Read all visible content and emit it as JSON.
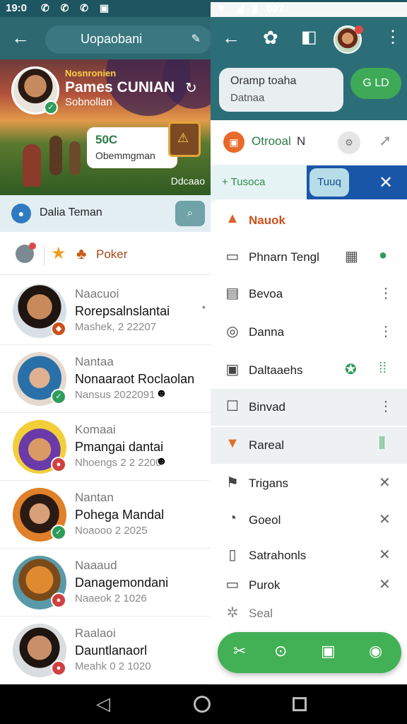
{
  "status": {
    "time": "19:0",
    "icons": "✆ ✆ ✆ ▣",
    "battery": "007"
  },
  "left": {
    "title": "Uopaobani",
    "banner": {
      "kicker": "Nosnronien",
      "name": "Pames CUNIAN",
      "sub": "Sobnollan",
      "card_amount": "50C",
      "card_label": "Obemmgman",
      "footer": "Ddcaao"
    },
    "search": {
      "label": "Dalia Teman"
    },
    "filter": {
      "tag": "Poker"
    },
    "chats": [
      {
        "top": "Naacuoi",
        "name": "Rorepsalnslantai",
        "sub": "Mashek, 2 22207",
        "badge_color": "#c8501a"
      },
      {
        "top": "Nantaa",
        "name": "Nonaaraot Roclaolan",
        "sub": "Nansus 2022091",
        "badge_color": "#2e9c5a"
      },
      {
        "top": "Komaai",
        "name": "Pmangai dantai",
        "sub": "Nhoengs 2 2 2200",
        "badge_color": "#d04040"
      },
      {
        "top": "Nantan",
        "name": "Pohega Mandal",
        "sub": "Noaooo 2 2025",
        "badge_color": "#2e9c5a"
      },
      {
        "top": "Naaaud",
        "name": "Danagemondani",
        "sub": "Naaeok 2 1026",
        "badge_color": "#d04040"
      },
      {
        "top": "Raalaoi",
        "name": "Dauntlanaorl",
        "sub": "Meahk 0 2 1020",
        "badge_color": "#d04040"
      }
    ]
  },
  "right": {
    "msg_line1": "Oramp toaha",
    "msg_line2": "Datnaa",
    "go_label": "G LD",
    "open_row": {
      "label": "Otrooal",
      "suffix": "N"
    },
    "tabs": {
      "left": "+ Tusoca",
      "active": "Tuuq"
    },
    "menu": [
      {
        "label": "Nauok"
      },
      {
        "label": "Phnarn Tengl"
      },
      {
        "label": "Bevoa"
      },
      {
        "label": "Danna"
      },
      {
        "label": "Daltaaehs"
      },
      {
        "label": "Binvad"
      },
      {
        "label": "Rareal"
      },
      {
        "label": "Trigans"
      },
      {
        "label": "Goeol"
      },
      {
        "label": "Satrahonls"
      },
      {
        "label": "Purok"
      },
      {
        "label": "Seal"
      }
    ]
  }
}
